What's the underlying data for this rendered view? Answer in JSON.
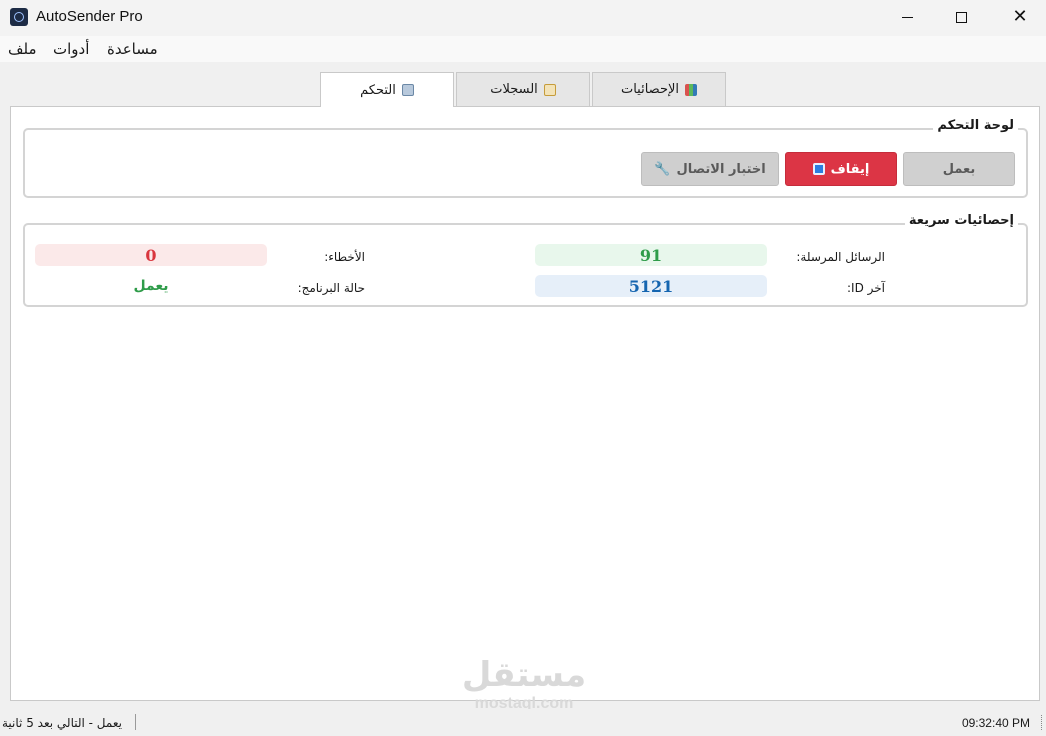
{
  "window": {
    "title": "AutoSender Pro",
    "min_symbol": "",
    "close_symbol": "✕"
  },
  "menu": {
    "file": "ملف",
    "tools": "أدوات",
    "help": "مساعدة"
  },
  "tabs": [
    {
      "label": "التحكم",
      "icon": "control-panel-icon",
      "active": true
    },
    {
      "label": "السجلات",
      "icon": "clipboard-icon",
      "active": false
    },
    {
      "label": "الإحصائيات",
      "icon": "bar-chart-icon",
      "active": false
    }
  ],
  "control_panel": {
    "title": "لوحة التحكم",
    "run_label": "بعمل",
    "stop_label": "إيقاف",
    "test_label": "اختبار الاتصال",
    "test_icon": "🔧"
  },
  "quick_stats": {
    "title": "إحصائيات سريعة",
    "sent_label": "الرسائل المرسلة:",
    "sent_value": "91",
    "errors_label": "الأخطاء:",
    "errors_value": "0",
    "last_id_label": "آخر ID:",
    "last_id_value": "5121",
    "status_label": "حالة البرنامج:",
    "status_value": "يعمل"
  },
  "watermark": {
    "arabic": "مستقل",
    "latin": "mostaql.com"
  },
  "status_bar": {
    "message": "يعمل - التالي بعد 5 ثانية",
    "time": "09:32:40 PM"
  },
  "colors": {
    "stop_button": "#dc3545",
    "sent_value": "#2f9c4a",
    "errors_value": "#d9363e",
    "last_id_value": "#1565b0"
  }
}
